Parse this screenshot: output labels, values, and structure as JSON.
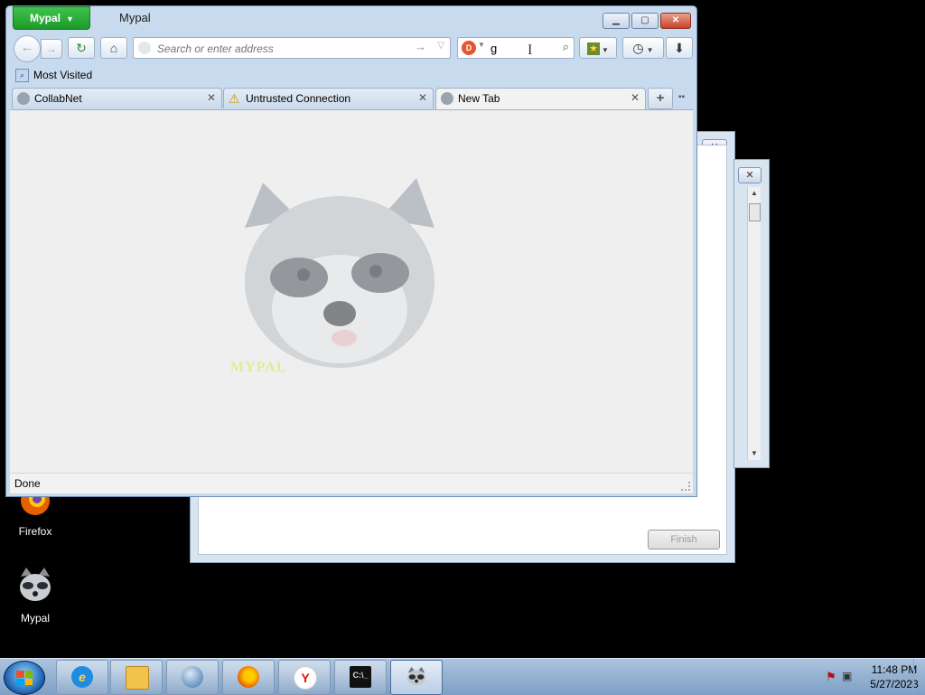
{
  "bg_dialog": {
    "finish_label": "Finish",
    "close_glyph": "✕"
  },
  "bg_dialog2": {
    "close_glyph": "✕"
  },
  "desktop_icons": [
    {
      "label": "Firefox",
      "icon": "firefox-icon"
    },
    {
      "label": "Mypal",
      "icon": "mypal-raccoon-icon"
    }
  ],
  "browser": {
    "app_button": "Mypal",
    "window_title": "Mypal",
    "address": {
      "placeholder": "Search or enter address",
      "value": ""
    },
    "search": {
      "engine_icon": "duckduckgo-icon",
      "value": "g"
    },
    "bookmarks_bar": {
      "most_visited": "Most Visited"
    },
    "tabs": [
      {
        "label": "CollabNet",
        "icon": "globe-icon",
        "active": false
      },
      {
        "label": "Untrusted Connection",
        "icon": "warning-icon",
        "active": false
      },
      {
        "label": "New Tab",
        "icon": "globe-icon",
        "active": true
      }
    ],
    "newtab_watermark_text": "MYPAL",
    "status": "Done"
  },
  "taskbar": {
    "items": [
      "start-orb",
      "internet-explorer",
      "file-explorer",
      "media-center",
      "firefox",
      "yandex-browser",
      "command-prompt",
      "mypal"
    ],
    "active_item": "mypal",
    "clock": {
      "time": "11:48 PM",
      "date": "5/27/2023"
    }
  },
  "colors": {
    "app_button": "#2aa836",
    "desktop": "#000000",
    "taskbar": "#8fb0d4",
    "close_button": "#c8422b"
  }
}
